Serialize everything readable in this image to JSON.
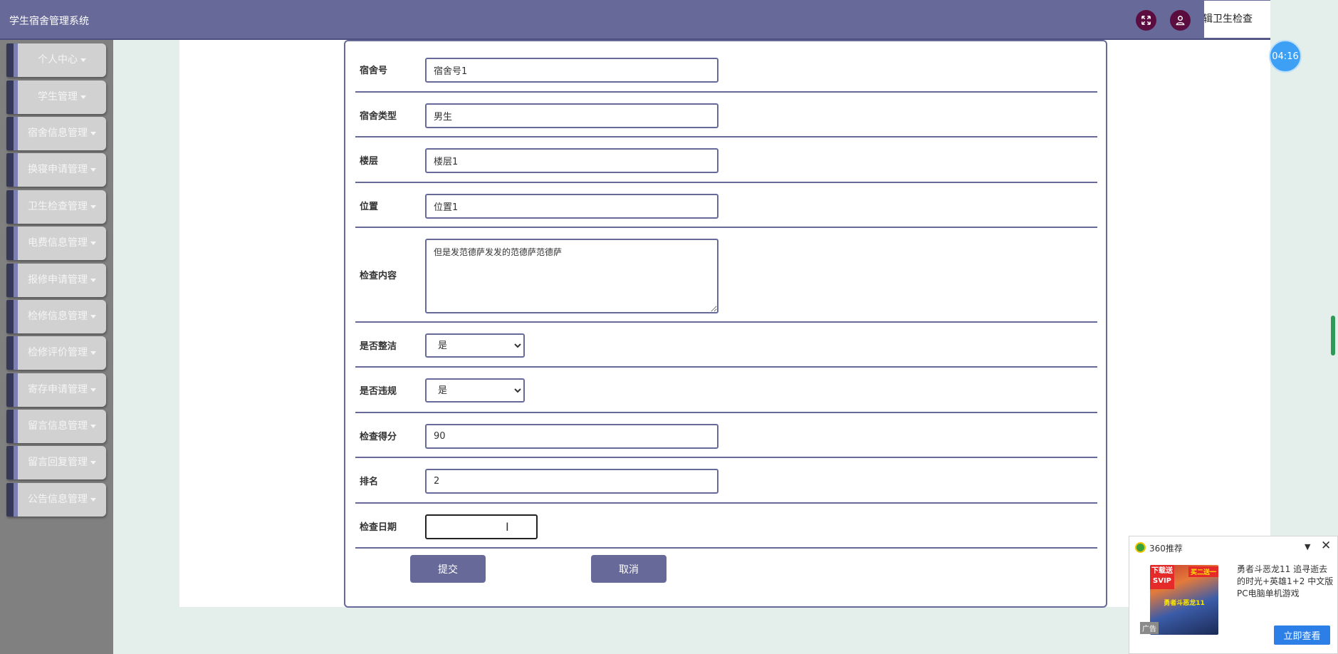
{
  "header": {
    "app_title": "学生宿舍管理系统",
    "current_tab": "编辑卫生检查",
    "icons": [
      "fullscreen-icon",
      "user-icon"
    ]
  },
  "sidebar": {
    "items": [
      {
        "label": "个人中心"
      },
      {
        "label": "学生管理"
      },
      {
        "label": "宿舍信息管理"
      },
      {
        "label": "换寝申请管理"
      },
      {
        "label": "卫生检查管理"
      },
      {
        "label": "电费信息管理"
      },
      {
        "label": "报修申请管理"
      },
      {
        "label": "检修信息管理"
      },
      {
        "label": "检修评价管理"
      },
      {
        "label": "寄存申请管理"
      },
      {
        "label": "留言信息管理"
      },
      {
        "label": "留言回复管理"
      },
      {
        "label": "公告信息管理"
      }
    ]
  },
  "form": {
    "dorm_no": {
      "label": "宿舍号",
      "value": "宿舍号1"
    },
    "dorm_type": {
      "label": "宿舍类型",
      "value": "男生"
    },
    "floor": {
      "label": "楼层",
      "value": "楼层1"
    },
    "location": {
      "label": "位置",
      "value": "位置1"
    },
    "content": {
      "label": "检查内容",
      "value": "但是发范德萨发发的范德萨范德萨"
    },
    "is_clean": {
      "label": "是否整洁",
      "value": "是"
    },
    "is_violation": {
      "label": "是否违规",
      "value": "是"
    },
    "score": {
      "label": "检查得分",
      "value": "90"
    },
    "rank": {
      "label": "排名",
      "value": "2"
    },
    "check_date": {
      "label": "检查日期",
      "value": ""
    },
    "submit_label": "提交",
    "cancel_label": "取消"
  },
  "timer": {
    "text": "04:16"
  },
  "ad": {
    "brand": "360推荐",
    "badge_left": "下载送SVIP",
    "badge_right": "买二送一",
    "image_title": "勇者斗恶龙11",
    "tag": "广告",
    "text": "勇者斗恶龙11 追寻逝去的时光+英雄1+2 中文版PC电脑单机游戏",
    "cta_label": "立即查看"
  },
  "colors": {
    "primary": "#676a99",
    "sidebar_bg": "#808080",
    "accent_dark": "#5c0d3f",
    "timer_blue": "#3da0f5",
    "ad_cta_blue": "#2b7fe6"
  }
}
